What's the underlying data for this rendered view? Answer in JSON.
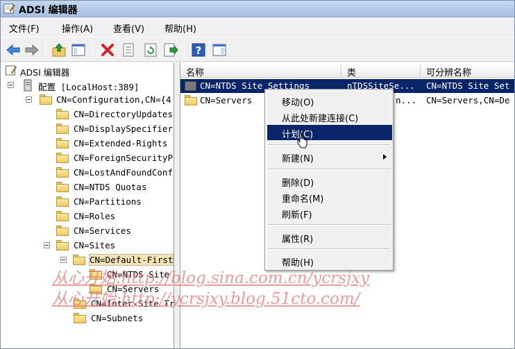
{
  "window": {
    "title": "ADSI 编辑器"
  },
  "menubar": [
    "文件(F)",
    "操作(A)",
    "查看(V)",
    "帮助(H)"
  ],
  "toolbar": {
    "buttons": [
      "back-arrow-icon",
      "forward-arrow-icon",
      "up-folder-icon",
      "show-hide-tree-icon",
      "delete-icon",
      "properties-icon",
      "refresh-icon",
      "export-list-icon",
      "help-icon",
      "show-hide-action-pane-icon"
    ]
  },
  "tree": {
    "root": "ADSI 编辑器",
    "connection": "配置 [LocalHost:389]",
    "configuration": "CN=Configuration,CN={4",
    "children": [
      "CN=DirectoryUpdates",
      "CN=DisplaySpecifier",
      "CN=Extended-Rights",
      "CN=ForeignSecurityP",
      "CN=LostAndFoundConf",
      "CN=NTDS Quotas",
      "CN=Partitions",
      "CN=Roles",
      "CN=Services"
    ],
    "sites": "CN=Sites",
    "default_first": "CN=Default-First",
    "ntds_site": "CN=NTDS Site",
    "servers": "CN=Servers",
    "inter_site": "CN=Inter-Site Tr",
    "subnets": "CN=Subnets"
  },
  "list": {
    "columns": [
      "名称",
      "类",
      "可分辨名称"
    ],
    "rows": [
      {
        "name": "CN=NTDS Site Settings",
        "class": "nTDSSiteSe...",
        "dn": "CN=NTDS Site Set"
      },
      {
        "name": "CN=Servers",
        "class": "n...",
        "dn": "CN=Servers,CN=De"
      }
    ]
  },
  "context_menu": {
    "items": [
      "移动(O)",
      "从此处新建连接(C)",
      "计划(C)",
      "新建(N)",
      "删除(D)",
      "重命名(M)",
      "刷新(F)",
      "属性(R)",
      "帮助(H)"
    ]
  },
  "watermark": {
    "line1": "从心开始:http://blog.sina.com.cn/ycrsjxy",
    "line2": "从心开始:http://ycrsjxy.blog.51cto.com/"
  },
  "colors": {
    "selection": "#0a246a",
    "folder": "#f1cb63",
    "watermark": "#e67878"
  }
}
